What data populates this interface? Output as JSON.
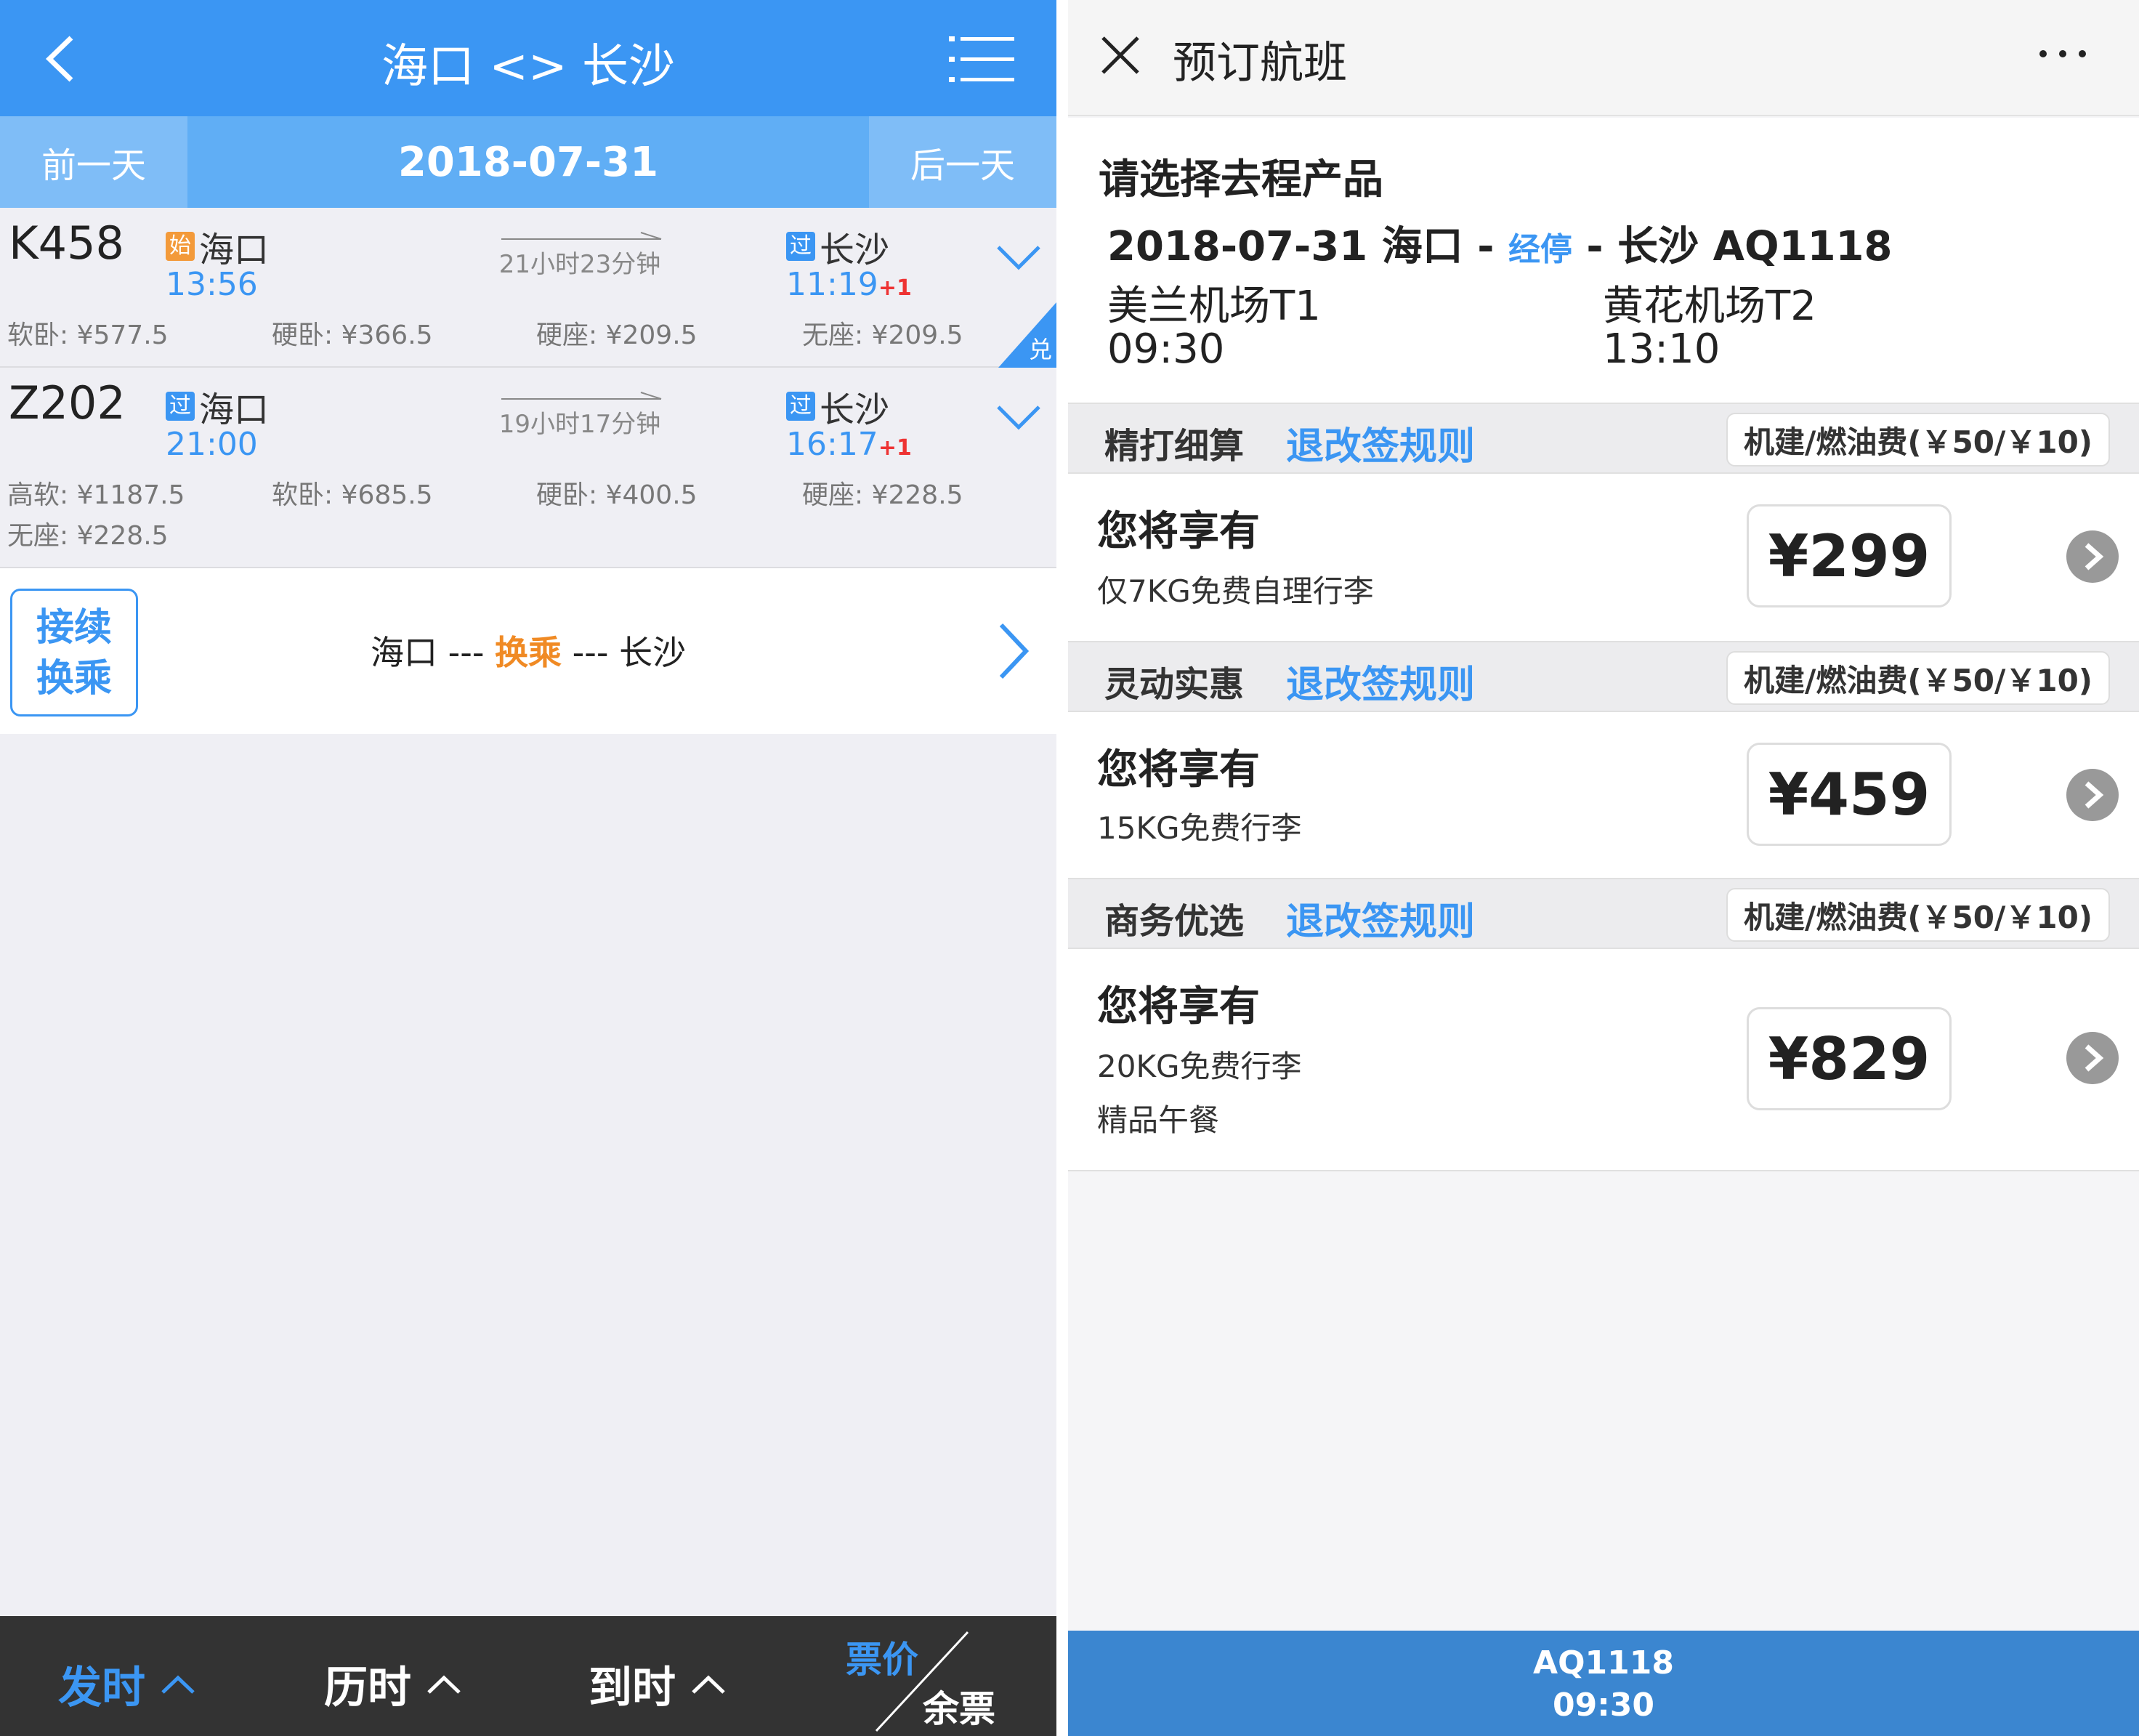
{
  "left": {
    "nav": {
      "title": "海口 <> 长沙"
    },
    "datebar": {
      "prev": "前一天",
      "date": "2018-07-31",
      "next": "后一天"
    },
    "trains": [
      {
        "no": "K458",
        "dep_tag": "始",
        "dep_station": "海口",
        "dep_time": "13:56",
        "duration": "21小时23分钟",
        "arr_tag": "过",
        "arr_station": "长沙",
        "arr_time": "11:19",
        "arr_plus": "+1",
        "fares": [
          "软卧: ¥577.5",
          "硬卧: ¥366.5",
          "硬座: ¥209.5",
          "无座: ¥209.5"
        ],
        "corner_badge": "兑"
      },
      {
        "no": "Z202",
        "dep_tag": "过",
        "dep_station": "海口",
        "dep_time": "21:00",
        "duration": "19小时17分钟",
        "arr_tag": "过",
        "arr_station": "长沙",
        "arr_time": "16:17",
        "arr_plus": "+1",
        "fares": [
          "高软: ¥1187.5",
          "软卧: ¥685.5",
          "硬卧: ¥400.5",
          "硬座: ¥228.5",
          "无座: ¥228.5"
        ]
      }
    ],
    "transfer": {
      "button_line1": "接续",
      "button_line2": "换乘",
      "from": "海口",
      "sep1": " --- ",
      "mid": "换乘",
      "sep2": " --- ",
      "to": "长沙"
    },
    "sortbar": {
      "items": [
        "发时",
        "历时",
        "到时"
      ],
      "active_index": 0,
      "split_top": "票价",
      "split_bottom": "余票"
    }
  },
  "right": {
    "header": {
      "title": "预订航班"
    },
    "info": {
      "heading": "请选择去程产品",
      "route_prefix": "2018-07-31 海口 - ",
      "stop_label": "经停",
      "route_suffix": " - 长沙 AQ1118",
      "dep_airport": "美兰机场T1",
      "dep_time": "09:30",
      "arr_airport": "黄花机场T2",
      "arr_time": "13:10"
    },
    "products": [
      {
        "name": "精打细算",
        "rule": "退改签规则",
        "fee": "机建/燃油费(￥50/￥10)",
        "enjoy": "您将享有",
        "benefits": [
          "仅7KG免费自理行李"
        ],
        "price": "¥299"
      },
      {
        "name": "灵动实惠",
        "rule": "退改签规则",
        "fee": "机建/燃油费(￥50/￥10)",
        "enjoy": "您将享有",
        "benefits": [
          "15KG免费行李"
        ],
        "price": "¥459"
      },
      {
        "name": "商务优选",
        "rule": "退改签规则",
        "fee": "机建/燃油费(￥50/￥10)",
        "enjoy": "您将享有",
        "benefits": [
          "20KG免费行李",
          "精品午餐"
        ],
        "price": "¥829"
      }
    ],
    "footer": {
      "flight": "AQ1118",
      "time": "09:30"
    }
  },
  "colors": {
    "primary": "#3b96f3",
    "orange": "#f08a24",
    "dark_bar": "#333333",
    "footer_blue": "#3b86d0"
  }
}
